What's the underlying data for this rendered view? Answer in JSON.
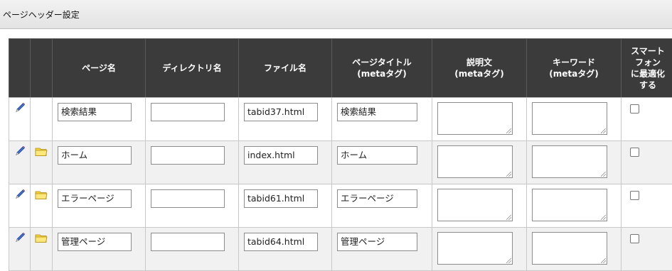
{
  "window": {
    "title": "ページヘッダー設定"
  },
  "table": {
    "headers": [
      {
        "key": "edit",
        "label": ""
      },
      {
        "key": "folder",
        "label": ""
      },
      {
        "key": "page_name",
        "label": "ページ名"
      },
      {
        "key": "directory",
        "label": "ディレクトリ名"
      },
      {
        "key": "file",
        "label": "ファイル名"
      },
      {
        "key": "page_title",
        "label_line1": "ページタイトル",
        "label_line2": "(metaタグ)"
      },
      {
        "key": "description",
        "label_line1": "説明文",
        "label_line2": "(metaタグ)"
      },
      {
        "key": "keywords",
        "label_line1": "キーワード",
        "label_line2": "(metaタグ)"
      },
      {
        "key": "smartphone",
        "label_lines": [
          "スマート",
          "フォン",
          "に最適化",
          "する"
        ]
      }
    ],
    "rows": [
      {
        "has_folder": false,
        "page_name": "検索結果",
        "directory": "",
        "file": "tabid37.html",
        "page_title": "検索結果",
        "description": "",
        "keywords": "",
        "smartphone": false
      },
      {
        "has_folder": true,
        "page_name": "ホーム",
        "directory": "",
        "file": "index.html",
        "page_title": "ホーム",
        "description": "",
        "keywords": "",
        "smartphone": false
      },
      {
        "has_folder": true,
        "page_name": "エラーページ",
        "directory": "",
        "file": "tabid61.html",
        "page_title": "エラーページ",
        "description": "",
        "keywords": "",
        "smartphone": false
      },
      {
        "has_folder": true,
        "page_name": "管理ページ",
        "directory": "",
        "file": "tabid64.html",
        "page_title": "管理ページ",
        "description": "",
        "keywords": "",
        "smartphone": false
      }
    ]
  },
  "icons": {
    "edit": "pencil-icon",
    "folder": "folder-icon"
  },
  "colors": {
    "header_bg": "#3b3b3b",
    "row_alt_bg": "#f1f1f1",
    "folder_fill": "#f5d43c",
    "pencil_body": "#3f6fd1"
  }
}
